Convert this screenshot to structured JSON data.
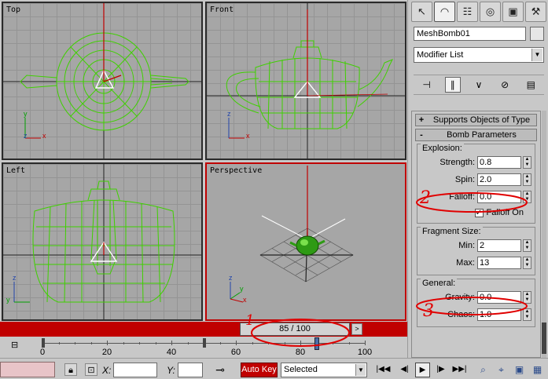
{
  "viewports": {
    "top": {
      "label": "Top"
    },
    "front": {
      "label": "Front"
    },
    "left": {
      "label": "Left"
    },
    "perspective": {
      "label": "Perspective"
    },
    "axis_x": "x",
    "axis_y": "y",
    "axis_z": "z"
  },
  "command_panel": {
    "tabs": [
      {
        "icon": "create-arrow-icon",
        "glyph": "↖"
      },
      {
        "icon": "modify-arc-icon",
        "glyph": "◠"
      },
      {
        "icon": "hierarchy-icon",
        "glyph": "☷"
      },
      {
        "icon": "motion-icon",
        "glyph": "◎"
      },
      {
        "icon": "display-icon",
        "glyph": "▣"
      },
      {
        "icon": "utilities-hammer-icon",
        "glyph": "⚒"
      }
    ],
    "object_name": "MeshBomb01",
    "modifier_list": "Modifier List",
    "stack_tools": [
      {
        "icon": "pin-stack-icon",
        "glyph": "⊣"
      },
      {
        "icon": "show-end-result-icon",
        "glyph": "∥"
      },
      {
        "icon": "make-unique-icon",
        "glyph": "∨"
      },
      {
        "icon": "remove-modifier-icon",
        "glyph": "⊘"
      },
      {
        "icon": "configure-sets-icon",
        "glyph": "▤"
      }
    ],
    "rollouts": {
      "supports": {
        "sign": "+",
        "title": "Supports Objects of Type"
      },
      "bomb": {
        "sign": "-",
        "title": "Bomb Parameters"
      }
    },
    "explosion": {
      "title": "Explosion:",
      "strength_label": "Strength:",
      "strength": "0.8",
      "spin_label": "Spin:",
      "spin": "2.0",
      "falloff_label": "Falloff:",
      "falloff": "0.0",
      "falloff_on_label": "Falloff On",
      "falloff_on_check": "✓"
    },
    "fragment": {
      "title": "Fragment Size:",
      "min_label": "Min:",
      "min": "2",
      "max_label": "Max:",
      "max": "13"
    },
    "general": {
      "title": "General:",
      "gravity_label": "Gravity:",
      "gravity": "0.0",
      "chaos_label": "Chaos:",
      "chaos": "1.0"
    }
  },
  "timeline": {
    "frame_display": "85 / 100",
    "next_arrow": ">",
    "current_frame": 85,
    "total_frames": 100,
    "ticks": [
      "0",
      "20",
      "40",
      "60",
      "80",
      "100"
    ]
  },
  "status_bar": {
    "x_label": "X:",
    "y_label": "Y:",
    "auto_key": "Auto Key",
    "selection": "Selected",
    "playback": [
      {
        "icon": "go-to-start-icon",
        "glyph": "|◀◀"
      },
      {
        "icon": "previous-frame-icon",
        "glyph": "◀|"
      },
      {
        "icon": "play-icon",
        "glyph": "▶"
      },
      {
        "icon": "next-frame-icon",
        "glyph": "|▶"
      },
      {
        "icon": "go-to-end-icon",
        "glyph": "▶▶|"
      }
    ],
    "nav_tools": [
      {
        "icon": "zoom-icon",
        "glyph": "⌕"
      },
      {
        "icon": "zoom-all-icon",
        "glyph": "⌖"
      },
      {
        "icon": "zoom-extents-icon",
        "glyph": "▣"
      },
      {
        "icon": "zoom-extents-all-icon",
        "glyph": "▦"
      }
    ]
  },
  "annotations": {
    "mark_1": "1",
    "mark_2": "2",
    "mark_3": "3"
  },
  "colors": {
    "wireframe": "#3fd000",
    "active_border": "#c00000",
    "annotation": "#e00000"
  }
}
